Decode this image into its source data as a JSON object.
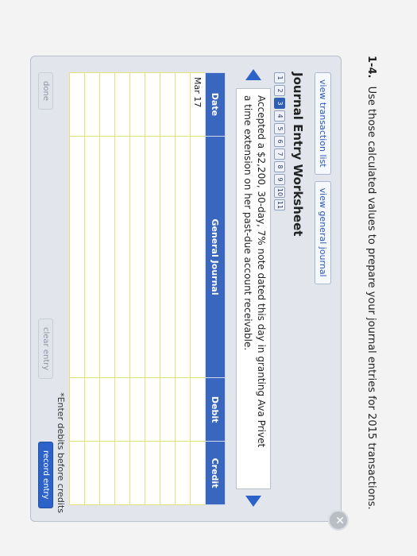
{
  "question": {
    "number": "1-4.",
    "text": "Use those calculated values to prepare your journal entries for 2015 transactions."
  },
  "worksheet": {
    "buttons": {
      "transactions": "view transaction list",
      "general_journal": "view general journal"
    },
    "title": "Journal Entry Worksheet",
    "steps": [
      "1",
      "2",
      "3",
      "4",
      "5",
      "6",
      "7",
      "8",
      "9",
      "10",
      "11"
    ],
    "active_step": "3",
    "description_line1": "Accepted a $2,200, 30-day, 7% note dated this day in granting Ava Privet",
    "description_line2": "a time extension on her past-due account receivable.",
    "table": {
      "headers": [
        "Date",
        "General Journal",
        "Debit",
        "Credit"
      ],
      "first_date": "Mar 17"
    },
    "note": "*Enter debits before credits",
    "actions": {
      "done": "done",
      "clear": "clear entry",
      "record": "record entry"
    }
  },
  "colors": {
    "accent": "#2d62c8",
    "header": "#3967c0"
  }
}
